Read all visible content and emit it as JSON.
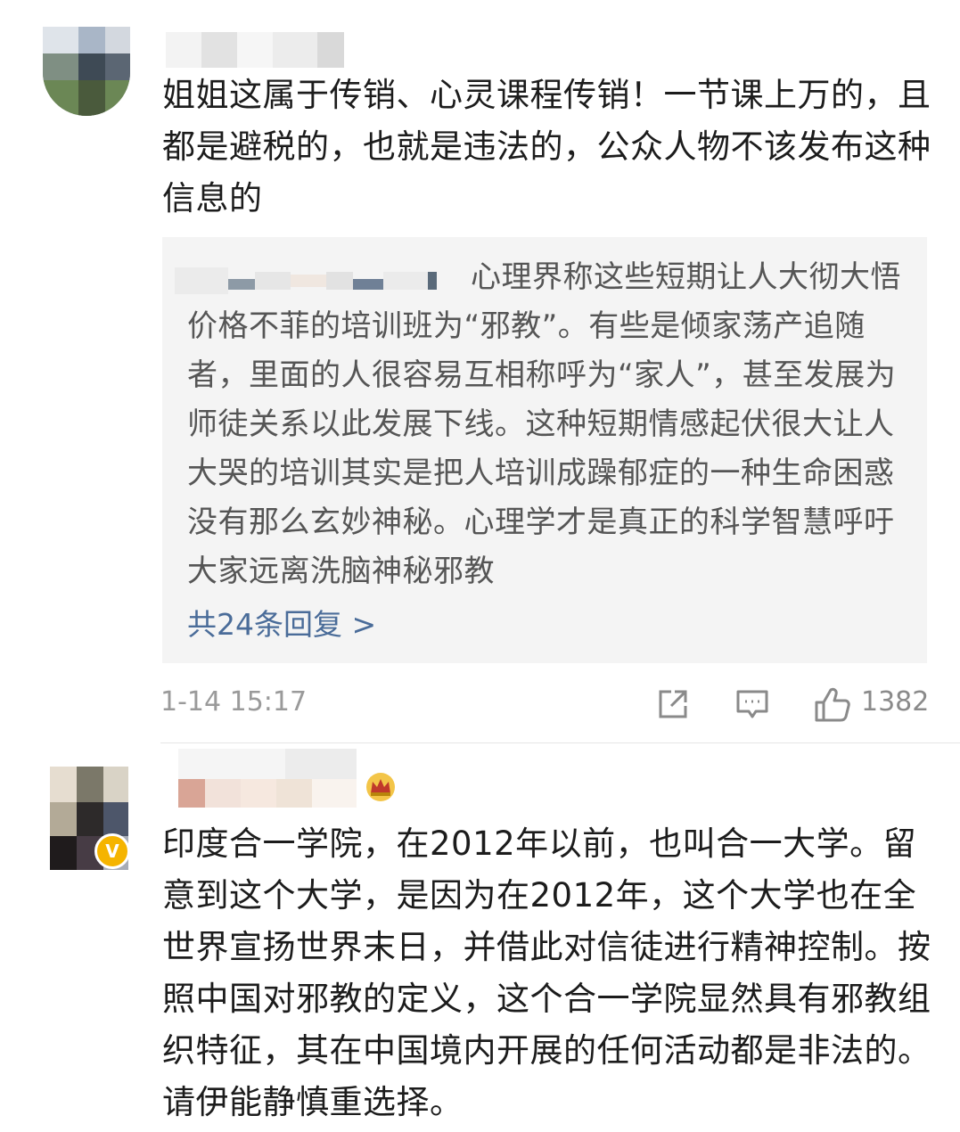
{
  "comments": [
    {
      "text": "姐姐这属于传销、心灵课程传销！一节课上万的，且都是避税的，也就是违法的，公众人物不该发布这种信息的",
      "reply": {
        "text": "心理界称这些短期让人大彻大悟价格不菲的培训班为“邪教”。有些是倾家荡产追随者，里面的人很容易互相称呼为“家人”，甚至发展为师徒关系以此发展下线。这种短期情感起伏很大让人大哭的培训其实是把人培训成躁郁症的一种生命困惑没有那么玄妙神秘。心理学才是真正的科学智慧呼吁大家远离洗脑神秘邪教",
        "reply_count_label": "共24条回复 >"
      },
      "timestamp": "1-14 15:17",
      "like_count": "1382",
      "icons": {
        "share": "share-icon",
        "comment": "comment-icon",
        "like": "thumbs-up-icon"
      }
    },
    {
      "text": "印度合一学院，在2012年以前，也叫合一大学。留意到这个大学，是因为在2012年，这个大学也在全世界宣扬世界末日，并借此对信徒进行精神控制。按照中国对邪教的定义，这个合一学院显然具有邪教组织特征，其在中国境内开展的任何活动都是非法的。请伊能静慎重选择。",
      "badges": {
        "verified": "verified-v-icon",
        "crown": "crown-icon"
      }
    }
  ],
  "colors": {
    "link": "#4a6c99",
    "reply_bg": "#f4f4f4",
    "meta": "#9a9a9a",
    "verified": "#f5b400"
  }
}
